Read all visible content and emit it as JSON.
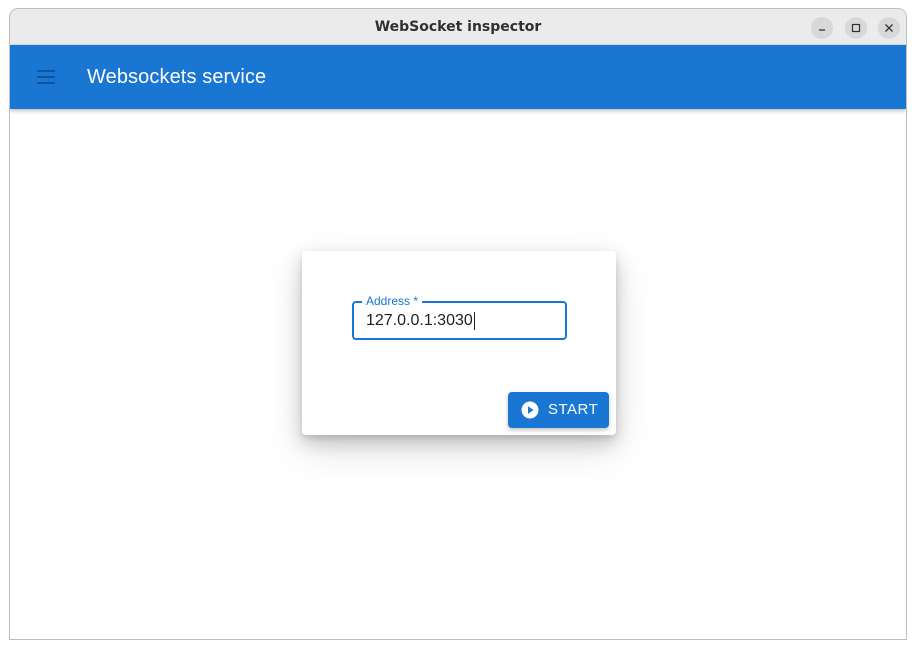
{
  "window": {
    "title": "WebSocket inspector",
    "controls": {
      "minimize_icon": "minimize-icon",
      "maximize_icon": "maximize-icon",
      "close_icon": "close-icon"
    }
  },
  "appbar": {
    "menu_icon": "hamburger-menu-icon",
    "title": "Websockets service",
    "color": "#1976d2"
  },
  "form": {
    "address": {
      "label": "Address *",
      "value": "127.0.0.1:3030",
      "focused": true
    },
    "start_button": {
      "icon": "play-circle-icon",
      "label": "START"
    }
  },
  "colors": {
    "accent": "#1976d2",
    "titlebar": "#ebebeb",
    "background": "#ffffff"
  }
}
